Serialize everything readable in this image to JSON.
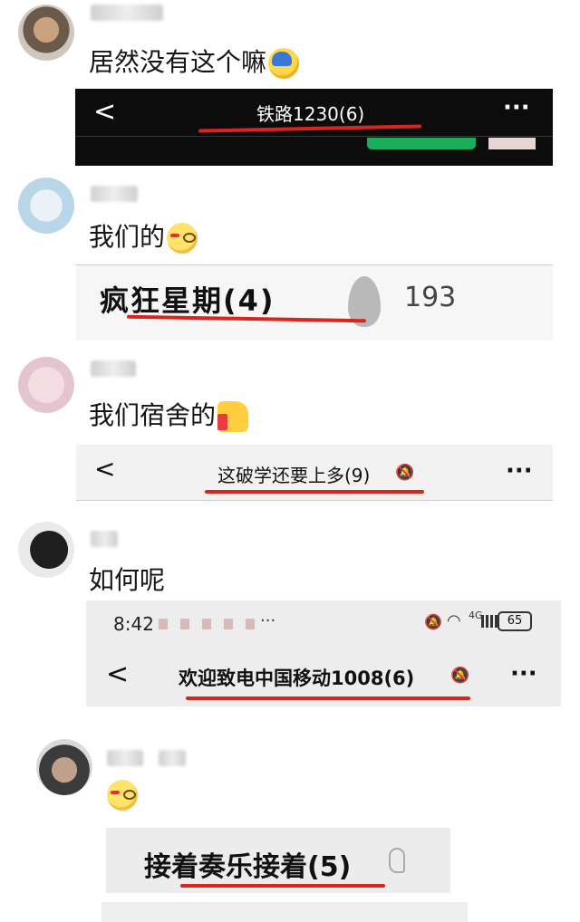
{
  "posts": [
    {
      "message": "居然没有这个嘛",
      "emoji": "hmm-face-emoji"
    },
    {
      "message": "我们的",
      "emoji": "smirk-face-emoji"
    },
    {
      "message": "我们宿舍的",
      "emoji": "thumbs-up-emoji"
    },
    {
      "message": "如何呢"
    },
    {
      "emoji": "smirk-face-emoji"
    }
  ],
  "shots": {
    "s1": {
      "title": "铁路1230(6)",
      "back": "<",
      "more": "···"
    },
    "s2": {
      "title": "疯狂星期(4)",
      "count": "193"
    },
    "s3": {
      "title": "这破学还要上多(9)",
      "back": "<",
      "more": "···"
    },
    "s4": {
      "time": "8:42",
      "battery": "65",
      "network": "4G",
      "status_dots": "···",
      "title": "欢迎致电中国移动1008(6)",
      "back": "<",
      "more": "···"
    },
    "s5": {
      "title": "接着奏乐接着(5)"
    }
  },
  "colors": {
    "underline": "#d9251b",
    "dark_bar": "#0c0c0c",
    "light_bar": "#f2f2f2",
    "green": "#1aad5c"
  }
}
